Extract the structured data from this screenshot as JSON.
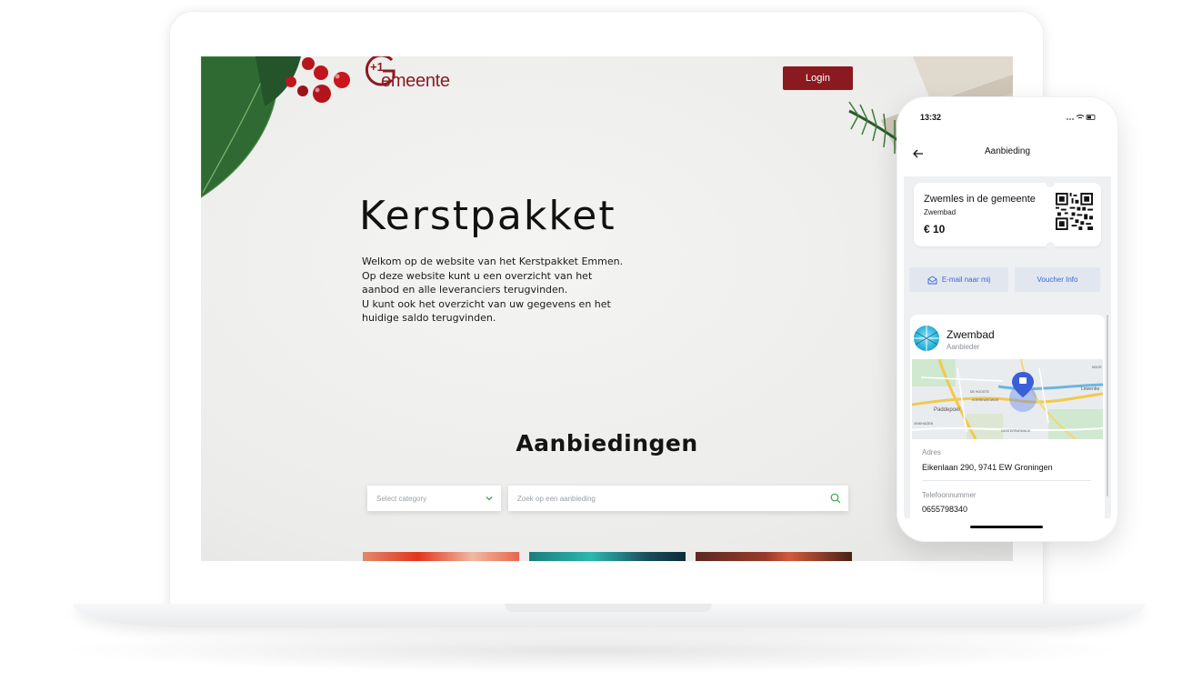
{
  "website": {
    "logo": {
      "prefix": "+1",
      "word": "emeente"
    },
    "login_label": "Login",
    "hero": {
      "title": "Kerstpakket",
      "lines": [
        "Welkom op de website van het Kerstpakket Emmen.",
        "Op deze website kunt u een overzicht van het",
        "aanbod en alle leveranciers terugvinden.",
        "U kunt ook het overzicht van uw gegevens en het",
        "huidige saldo terugvinden."
      ]
    },
    "offers_title": "Aanbiedingen",
    "category_select": {
      "placeholder": "Select category",
      "icon": "chevron-down-icon"
    },
    "search": {
      "placeholder": "Zoek op een aanbieding",
      "icon": "search-icon"
    },
    "brand_color": "#8a1a1f",
    "accent_green": "#3aa74a"
  },
  "phone": {
    "status": {
      "time": "13:32",
      "icons": "... ▾ ▮"
    },
    "app_bar": {
      "title": "Aanbieding",
      "back_icon": "back-arrow-icon"
    },
    "ticket": {
      "title": "Zwemles in de gemeente",
      "subtitle": "Zwembad",
      "price": "€ 10"
    },
    "actions": {
      "email_label": "E-mail naar mij",
      "voucher_label": "Voucher Info",
      "accent": "#3a68d8"
    },
    "provider": {
      "name": "Zwembad",
      "role": "Aanbieder",
      "address_label": "Adres",
      "address": "Eikenlaan 290, 9741 EW Groningen",
      "phone_label": "Telefoonnummer",
      "phone": "0655798340"
    },
    "map": {
      "labels": [
        "Paddepoel",
        "DE HOOGTE",
        "KORREWEGWIJK",
        "Lewenbo",
        "OOSTERPARKWIJK",
        "VINKHUIZEN",
        "NOOR"
      ]
    }
  }
}
